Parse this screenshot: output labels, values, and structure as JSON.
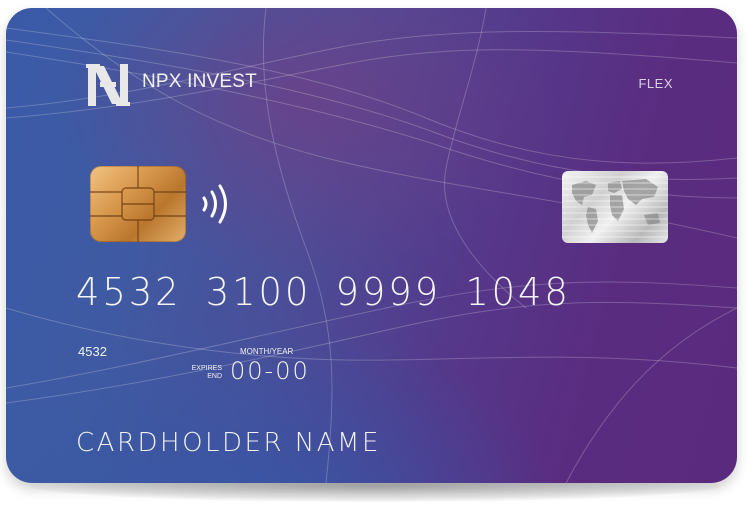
{
  "card": {
    "brand_name": "NPX INVEST",
    "tier": "FLEX",
    "number": "4532 3100 9999 1048",
    "bin_label": "4532",
    "expires_label_line1": "EXPIRES",
    "expires_label_line2": "END",
    "month_year_label": "MONTH/YEAR",
    "expiry": "00-00",
    "holder_name": "CARDHOLDER NAME",
    "logo_icon": "npx-monogram-logo",
    "chip_icon": "emv-chip-icon",
    "contactless_icon": "contactless-icon",
    "hologram_icon": "world-map-hologram-icon"
  },
  "colors": {
    "card_blue": "#3a5aa8",
    "card_purple": "#5a2a7e",
    "text": "#f4f4f4",
    "chip_gold": "#d99a4f",
    "hologram_silver": "#cfcfcf"
  }
}
